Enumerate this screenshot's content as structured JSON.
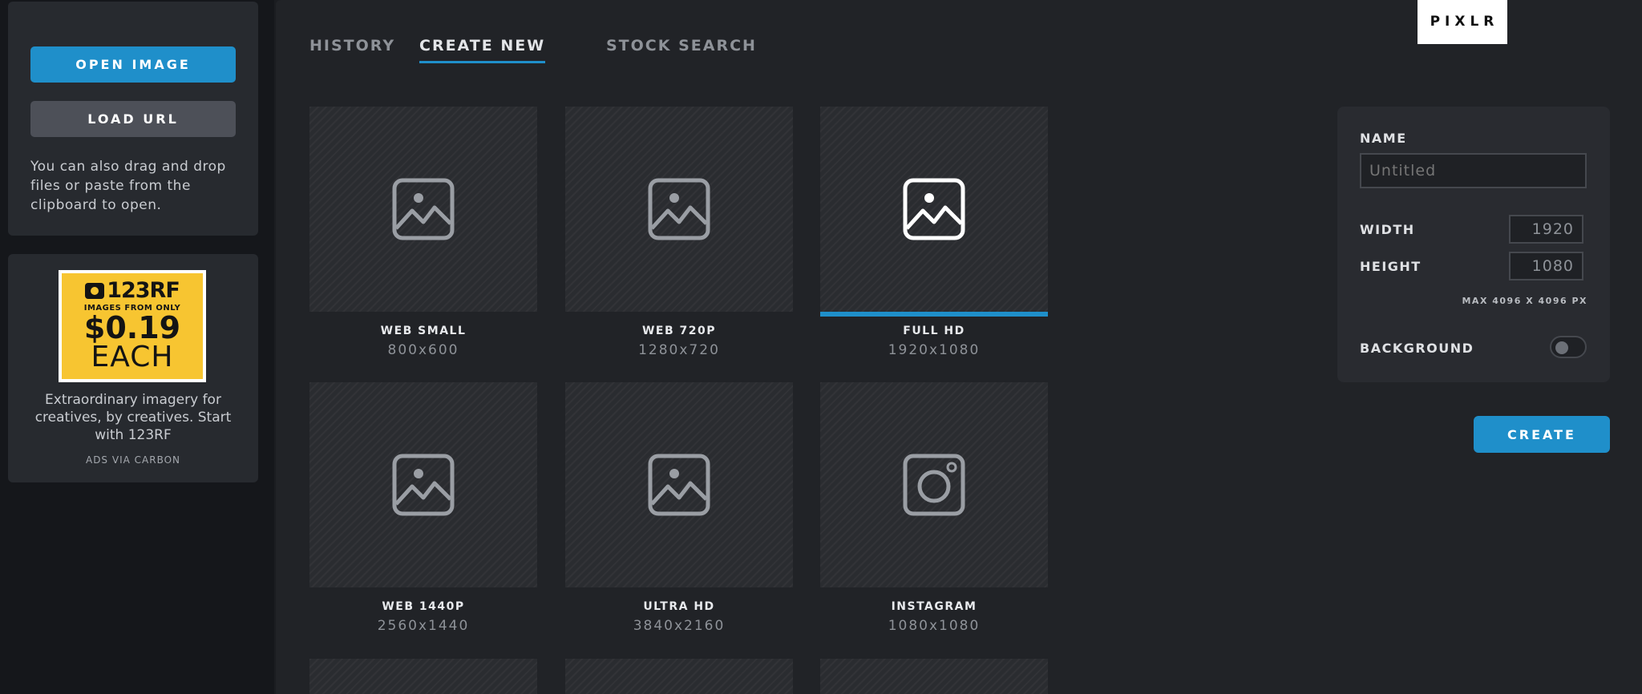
{
  "sidebar": {
    "open_image_label": "OPEN IMAGE",
    "load_url_label": "LOAD URL",
    "drag_hint": "You can also drag and drop files or paste from the clipboard to open.",
    "ad": {
      "brand": "123RF",
      "subline": "IMAGES FROM ONLY",
      "price": "$0.19",
      "each": "EACH",
      "text": "Extraordinary imagery for creatives, by creatives. Start with 123RF",
      "via": "ADS VIA CARBON"
    }
  },
  "header": {
    "tabs": [
      {
        "label": "HISTORY",
        "active": false
      },
      {
        "label": "CREATE NEW",
        "active": true
      },
      {
        "label": "STOCK SEARCH",
        "active": false
      }
    ],
    "logo": "PIXLR"
  },
  "presets": [
    {
      "label": "WEB SMALL",
      "size": "800x600",
      "icon": "image-icon",
      "selected": false
    },
    {
      "label": "WEB 720P",
      "size": "1280x720",
      "icon": "image-icon",
      "selected": false
    },
    {
      "label": "FULL HD",
      "size": "1920x1080",
      "icon": "image-icon",
      "selected": true
    },
    {
      "label": "WEB 1440P",
      "size": "2560x1440",
      "icon": "image-icon",
      "selected": false
    },
    {
      "label": "ULTRA HD",
      "size": "3840x2160",
      "icon": "image-icon",
      "selected": false
    },
    {
      "label": "INSTAGRAM",
      "size": "1080x1080",
      "icon": "instagram-icon",
      "selected": false
    }
  ],
  "form": {
    "name_label": "NAME",
    "name_placeholder": "Untitled",
    "width_label": "WIDTH",
    "width_value": "1920",
    "height_label": "HEIGHT",
    "height_value": "1080",
    "max_note": "MAX 4096 X 4096 PX",
    "background_label": "BACKGROUND",
    "background_on": false,
    "create_label": "CREATE"
  },
  "colors": {
    "accent": "#1f8fca",
    "background": "#212327",
    "sidebar": "#15171b",
    "ad_yellow": "#f7c531"
  }
}
